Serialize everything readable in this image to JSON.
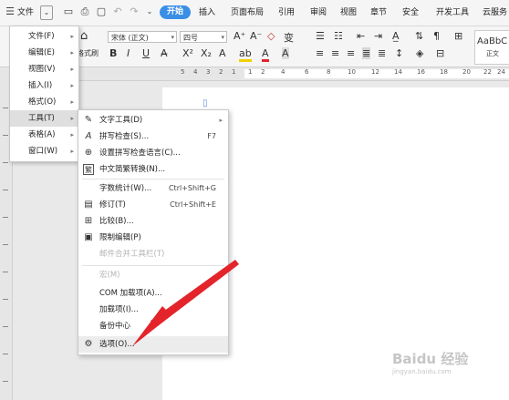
{
  "menubar": {
    "file_label": "文件",
    "tabs": [
      {
        "label": "开始"
      },
      {
        "label": "插入"
      },
      {
        "label": "页面布局"
      },
      {
        "label": "引用"
      },
      {
        "label": "审阅"
      },
      {
        "label": "视图"
      },
      {
        "label": "章节"
      },
      {
        "label": "安全"
      },
      {
        "label": "开发工具"
      },
      {
        "label": "云服务"
      }
    ]
  },
  "ribbon": {
    "font_name": "宋体 (正文)",
    "font_size": "四号",
    "format_painter_label": "格式刷",
    "style_preview": "AaBbC",
    "style_name": "正文",
    "buttons": {
      "bold": "B",
      "italic": "I",
      "underline": "U",
      "grow": "A⁺",
      "shrink": "A⁻"
    }
  },
  "ruler": {
    "numbers": [
      "5",
      "4",
      "3",
      "2",
      "1",
      "1",
      "2",
      "4",
      "6",
      "8",
      "10",
      "12",
      "14",
      "16",
      "18",
      "20",
      "22",
      "24"
    ]
  },
  "file_menu": {
    "items": [
      {
        "label": "文件(F)"
      },
      {
        "label": "编辑(E)"
      },
      {
        "label": "视图(V)"
      },
      {
        "label": "插入(I)"
      },
      {
        "label": "格式(O)"
      },
      {
        "label": "工具(T)"
      },
      {
        "label": "表格(A)"
      },
      {
        "label": "窗口(W)"
      }
    ]
  },
  "tools_menu": {
    "items": [
      {
        "label": "文字工具(D)",
        "shortcut": "",
        "icon": "text-tool-icon",
        "glyph": "✎"
      },
      {
        "label": "拼写检查(S)...",
        "shortcut": "F7",
        "icon": "spell-check-icon",
        "glyph": "A"
      },
      {
        "label": "设置拼写检查语言(C)...",
        "shortcut": "",
        "icon": "language-icon",
        "glyph": "⊕"
      },
      {
        "label": "中文简繁转换(N)...",
        "shortcut": "",
        "icon": "convert-icon",
        "glyph": "繁"
      },
      {
        "label": "字数统计(W)...",
        "shortcut": "Ctrl+Shift+G",
        "icon": "word-count-icon",
        "glyph": ""
      },
      {
        "label": "修订(T)",
        "shortcut": "Ctrl+Shift+E",
        "icon": "revision-icon",
        "glyph": "▤"
      },
      {
        "label": "比较(B)...",
        "shortcut": "",
        "icon": "compare-icon",
        "glyph": "⊞"
      },
      {
        "label": "限制编辑(P)",
        "shortcut": "",
        "icon": "restrict-edit-icon",
        "glyph": "▣"
      },
      {
        "label": "邮件合并工具栏(T)",
        "shortcut": "",
        "icon": "",
        "glyph": ""
      },
      {
        "label": "宏(M)",
        "shortcut": "",
        "icon": "",
        "glyph": ""
      },
      {
        "label": "COM 加载项(A)...",
        "shortcut": "",
        "icon": "",
        "glyph": ""
      },
      {
        "label": "加载项(I)...",
        "shortcut": "",
        "icon": "",
        "glyph": ""
      },
      {
        "label": "备份中心",
        "shortcut": "",
        "icon": "",
        "glyph": ""
      },
      {
        "label": "选项(O)...",
        "shortcut": "",
        "icon": "options-gear-icon",
        "glyph": "⚙"
      }
    ]
  },
  "colors": {
    "accent": "#3a8ee6",
    "arrow_red": "#e3242b",
    "menu_hover": "#dfdfdf"
  },
  "watermark": {
    "text": "Baidu 经验",
    "sub": "jingyan.baidu.com"
  }
}
